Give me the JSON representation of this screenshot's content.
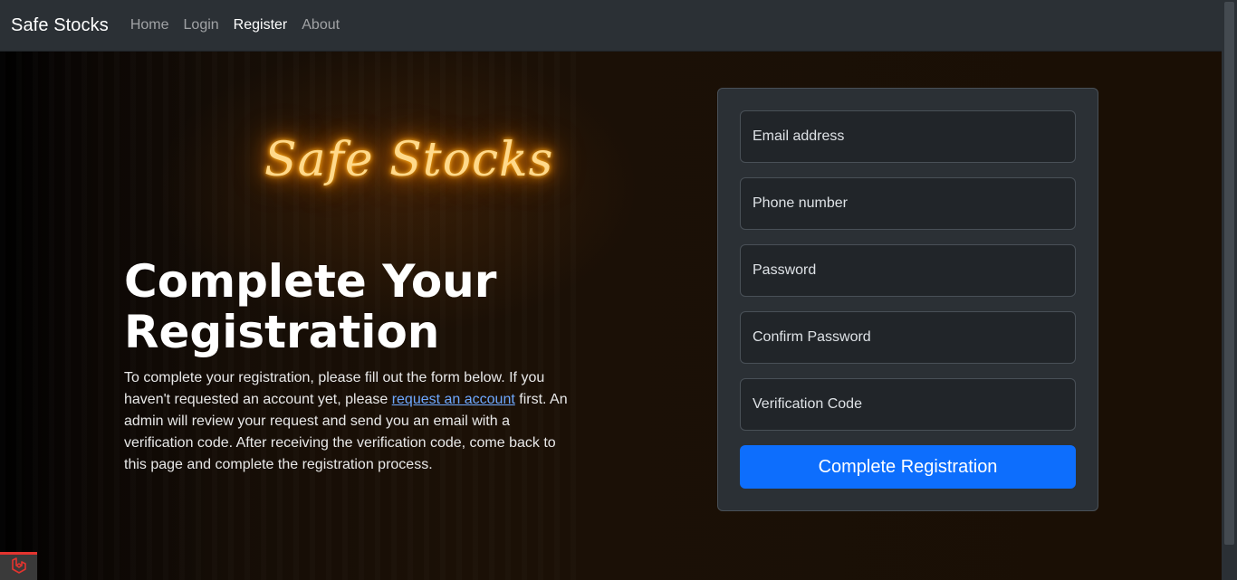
{
  "nav": {
    "brand": "Safe Stocks",
    "links": [
      "Home",
      "Login",
      "Register",
      "About"
    ],
    "active": "Register"
  },
  "hero": {
    "logo_text": "Safe Stocks",
    "title_line1": "Complete Your",
    "title_line2": "Registration",
    "paragraph_before": "To complete your registration, please fill out the form below. If you haven't requested an account yet, please ",
    "link_text": "request an account",
    "paragraph_after": " first. An admin will review your request and send you an email with a verification code. After receiving the verification code, come back to this page and complete the registration process."
  },
  "form": {
    "email_placeholder": "Email address",
    "phone_placeholder": "Phone number",
    "password_placeholder": "Password",
    "confirm_placeholder": "Confirm Password",
    "code_placeholder": "Verification Code",
    "submit_label": "Complete Registration"
  },
  "colors": {
    "navbar_bg": "#2b3035",
    "primary": "#0d6efd",
    "neon": "#ffb020",
    "link": "#6ea8fe"
  },
  "icons": {
    "debug_bar": "laravel-icon"
  }
}
